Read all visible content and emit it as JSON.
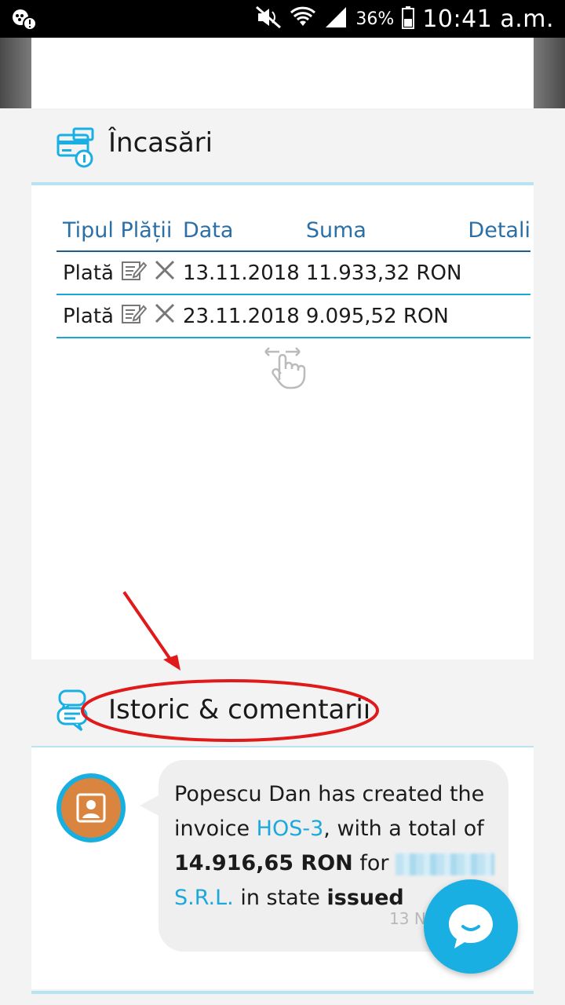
{
  "status_bar": {
    "battery_percent": "36%",
    "time": "10:41 a.m."
  },
  "incasari": {
    "title": "Încasări",
    "columns": [
      "Tipul Plății",
      "Data",
      "Suma",
      "Detali"
    ],
    "rows": [
      {
        "type": "Plată",
        "date": "13.11.2018",
        "amount": "11.933,32 RON"
      },
      {
        "type": "Plată",
        "date": "23.11.2018",
        "amount": "9.095,52 RON"
      }
    ]
  },
  "history": {
    "title": "Istoric & comentarii",
    "message": {
      "author": "Popescu Dan",
      "text_1": " has created the invoice ",
      "invoice": "HOS-3",
      "text_2": ", with a total of ",
      "total": "14.916,65 RON",
      "text_3": " for ",
      "company_suffix": "S.R.L.",
      "text_4": " in state ",
      "state": "issued",
      "timestamp": "13 Nov 2"
    }
  },
  "colors": {
    "accent": "#1aafe3",
    "header_blue": "#2a6fa8",
    "annotation_red": "#e0191a",
    "avatar_orange": "#d9843f"
  }
}
